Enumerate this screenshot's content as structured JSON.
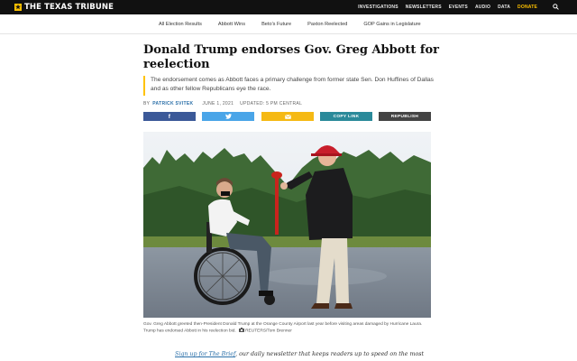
{
  "site": {
    "logo_text": "THE TEXAS TRIBUNE",
    "logo_mark": "★",
    "nav": [
      "INVESTIGATIONS",
      "NEWSLETTERS",
      "EVENTS",
      "AUDIO",
      "DATA"
    ],
    "donate": "DONATE",
    "accent": "#ffc200"
  },
  "subnav": [
    "All Election Results",
    "Abbott Wins",
    "Beto's Future",
    "Paxton Reelected",
    "GOP Gains in Legislature"
  ],
  "article": {
    "headline": "Donald Trump endorses Gov. Greg Abbott for reelection",
    "dek": "The endorsement comes as Abbott faces a primary challenge from former state Sen. Don Huffines of Dallas and as other fellow Republicans eye the race.",
    "byline_prefix": "BY",
    "author": "PATRICK SVITEK",
    "date": "JUNE 1, 2021",
    "updated": "UPDATED: 5 PM CENTRAL"
  },
  "share": {
    "facebook_glyph": "f",
    "twitter_glyph": "🐦",
    "email_glyph": "✉",
    "copy_label": "COPY LINK",
    "republish_label": "REPUBLISH"
  },
  "photo": {
    "caption": "Gov. Greg Abbott greeted then-President Donald Trump at the Orange County Airport last year before visiting areas damaged by Hurricane Laura. Trump has endorsed Abbott in his reelection bid.",
    "credit_icon": "camera-icon",
    "credit": "REUTERS/Tom Brenner"
  },
  "promo": {
    "link_text": "Sign up for The Brief",
    "rest": ", our daily newsletter that keeps readers up to speed on the most"
  }
}
